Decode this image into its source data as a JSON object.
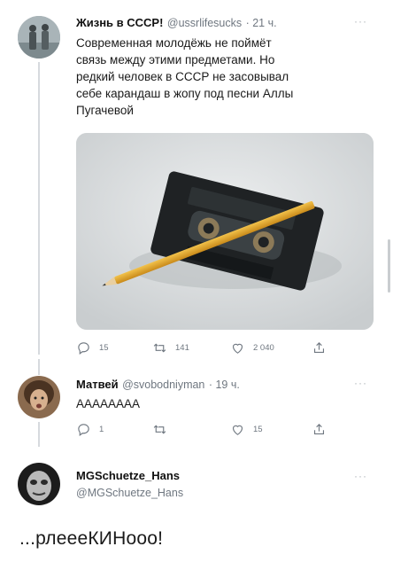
{
  "tweet1": {
    "name": "Жизнь в СССР!",
    "handle": "@ussrlifesucks",
    "time": "· 21 ч.",
    "text": "Современная молодёжь не поймёт связь между этими предметами. Но редкий человек в СССР не засовывал себе карандаш в жопу под песни Аллы Пугачевой",
    "actions": {
      "reply": "15",
      "retweet": "141",
      "like": "2 040"
    },
    "more": "···"
  },
  "tweet2": {
    "name": "Матвей",
    "handle": "@svobodniyman",
    "time": "· 19 ч.",
    "text": "АААААААА",
    "actions": {
      "reply": "1",
      "retweet": "",
      "like": "15"
    },
    "more": "···"
  },
  "tweet3": {
    "name": "MGSchuetze_Hans",
    "handle": "@MGSchuetze_Hans",
    "more": "···"
  },
  "footer_text": "...рлеееКИНооо!",
  "icons": [
    "reply-icon",
    "retweet-icon",
    "like-icon",
    "share-icon",
    "more-icon"
  ],
  "colors": {
    "handle": "#6f7780",
    "divider": "#eceff1",
    "thread_line": "#d6dade"
  }
}
